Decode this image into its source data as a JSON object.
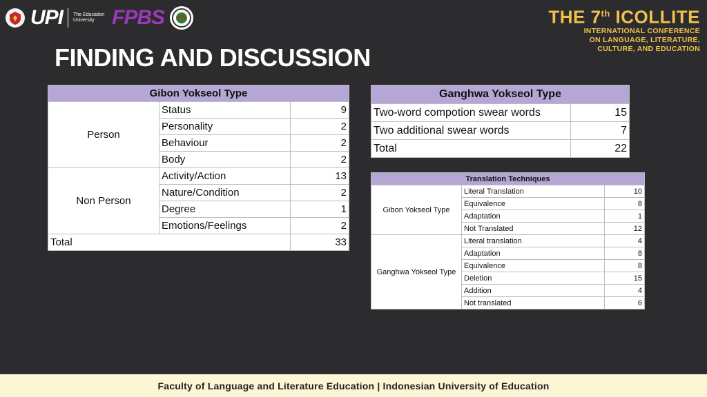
{
  "header": {
    "upi_logo_text": "UPI",
    "upi_subtitle": "The Education University",
    "fpbs_logo_text": "FPBS",
    "conference": {
      "line1_prefix": "THE 7",
      "line1_sup": "th",
      "line1_suffix": " ICOLLITE",
      "line2": "INTERNATIONAL CONFERENCE",
      "line3": "ON LANGUAGE, LITERATURE,",
      "line4": "CULTURE, AND EDUCATION"
    }
  },
  "title": "FINDING AND DISCUSSION",
  "colors": {
    "background": "#2c2c2e",
    "table_header": "#b4a7d6",
    "conference_gold": "#f2c14b",
    "footer_bg": "#fdf6d4"
  },
  "gibon_table": {
    "header": "Gibon Yokseol Type",
    "groups": [
      {
        "name": "Person",
        "rows": [
          {
            "label": "Status",
            "value": "9"
          },
          {
            "label": "Personality",
            "value": "2"
          },
          {
            "label": "Behaviour",
            "value": "2"
          },
          {
            "label": "Body",
            "value": "2"
          }
        ]
      },
      {
        "name": "Non Person",
        "rows": [
          {
            "label": "Activity/Action",
            "value": "13"
          },
          {
            "label": "Nature/Condition",
            "value": "2"
          },
          {
            "label": "Degree",
            "value": "1"
          },
          {
            "label": "Emotions/Feelings",
            "value": "2"
          }
        ]
      }
    ],
    "total_label": "Total",
    "total_value": "33"
  },
  "ganghwa_table": {
    "header": "Ganghwa Yokseol Type",
    "rows": [
      {
        "label": "Two-word compotion swear words",
        "value": "15"
      },
      {
        "label": "Two additional swear words",
        "value": "7"
      },
      {
        "label": "Total",
        "value": "22"
      }
    ]
  },
  "translation_table": {
    "header": "Translation Techniques",
    "groups": [
      {
        "name": "Gibon Yokseol Type",
        "rows": [
          {
            "label": "Literal  Translation",
            "value": "10"
          },
          {
            "label": "Equivalence",
            "value": "8"
          },
          {
            "label": "Adaptation",
            "value": "1"
          },
          {
            "label": "Not Translated",
            "value": "12"
          }
        ]
      },
      {
        "name": "Ganghwa Yokseol Type",
        "rows": [
          {
            "label": "Literal translation",
            "value": "4"
          },
          {
            "label": "Adaptation",
            "value": "8"
          },
          {
            "label": "Equivalence",
            "value": "8"
          },
          {
            "label": "Deletion",
            "value": "15"
          },
          {
            "label": "Addition",
            "value": "4"
          },
          {
            "label": "Not translated",
            "value": "6"
          }
        ]
      }
    ]
  },
  "footer": "Faculty of Language and Literature Education | Indonesian University of Education"
}
